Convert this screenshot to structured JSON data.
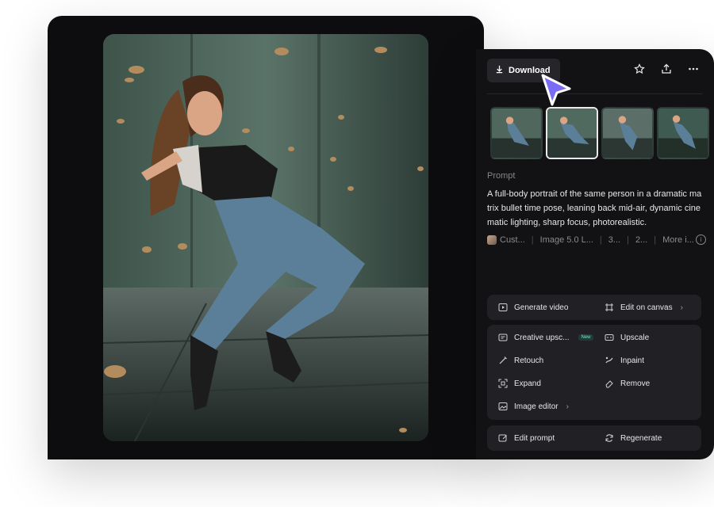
{
  "toolbar": {
    "download_label": "Download",
    "icons": [
      "star-icon",
      "share-icon",
      "more-icon"
    ]
  },
  "prompt": {
    "label": "Prompt",
    "text": "A full-body portrait of the same person in a dramatic matrix bullet time pose, leaning back mid-air, dynamic cinematic lighting, sharp focus, photorealistic."
  },
  "meta": {
    "style": "Cust...",
    "model": "Image 5.0 L...",
    "count": "3...",
    "ratio": "2...",
    "more": "More i..."
  },
  "actions": {
    "generate_video": "Generate video",
    "edit_on_canvas": "Edit on canvas",
    "creative_upscale": "Creative upsc...",
    "new_badge": "New",
    "upscale": "Upscale",
    "retouch": "Retouch",
    "inpaint": "Inpaint",
    "expand": "Expand",
    "remove": "Remove",
    "image_editor": "Image editor",
    "edit_prompt": "Edit prompt",
    "regenerate": "Regenerate"
  },
  "thumbnails": {
    "count": 4,
    "selected_index": 1
  },
  "colors": {
    "panel_bg": "#121214",
    "action_bg": "#212125",
    "cursor": "#7b6cf6"
  }
}
